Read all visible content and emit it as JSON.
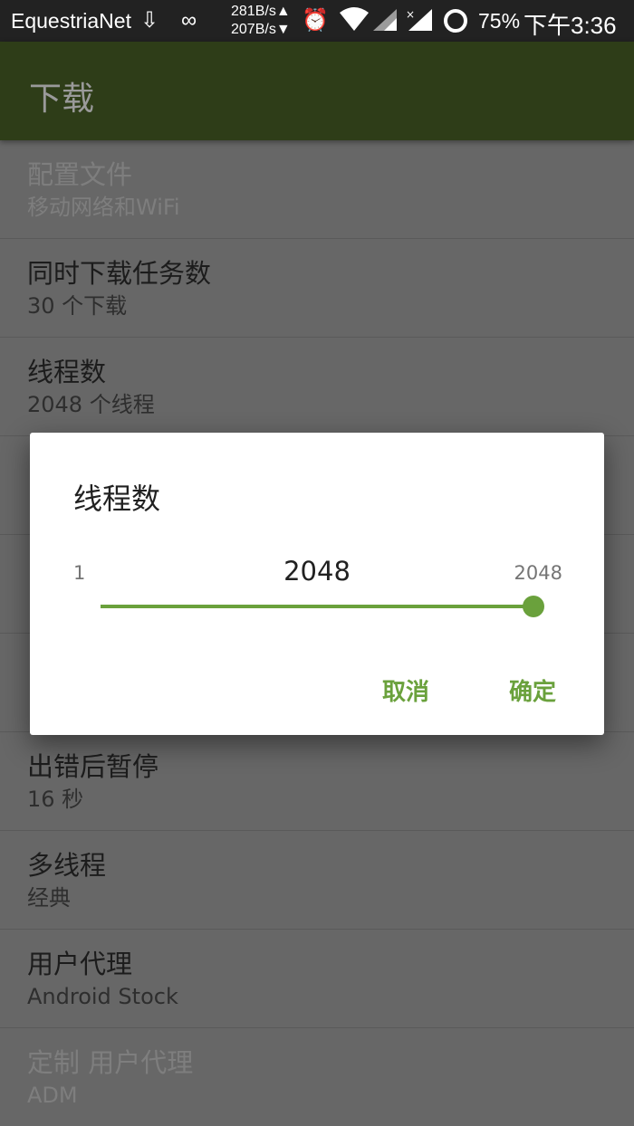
{
  "status_bar": {
    "carrier": "EquestriaNet",
    "speed_up": "281B/s▲",
    "speed_down": "207B/s▼",
    "battery": "75%",
    "time": "下午3:36",
    "icons": [
      "download-notify-icon",
      "infinity-icon",
      "alarm-icon",
      "wifi-icon",
      "signal-icon",
      "signal-x-icon",
      "battery-ring-icon"
    ]
  },
  "app_bar": {
    "title": "下载"
  },
  "settings": [
    {
      "title": "配置文件",
      "summary": "移动网络和WiFi",
      "enabled": false
    },
    {
      "title": "同时下载任务数",
      "summary": "30 个下载",
      "enabled": true
    },
    {
      "title": "线程数",
      "summary": "2048 个线程",
      "enabled": true
    },
    {
      "title": "",
      "summary": "",
      "enabled": true
    },
    {
      "title": "",
      "summary": "",
      "enabled": true
    },
    {
      "title": "",
      "summary": "",
      "enabled": true
    },
    {
      "title": "出错后暂停",
      "summary": "16 秒",
      "enabled": true
    },
    {
      "title": "多线程",
      "summary": "经典",
      "enabled": true
    },
    {
      "title": "用户代理",
      "summary": "Android Stock",
      "enabled": true
    },
    {
      "title": "定制 用户代理",
      "summary": "ADM",
      "enabled": false
    }
  ],
  "dialog": {
    "title": "线程数",
    "slider": {
      "min": "1",
      "max": "2048",
      "value": "2048",
      "fraction": 1.0
    },
    "cancel_label": "取消",
    "ok_label": "确定"
  },
  "colors": {
    "accent": "#6aa13c",
    "app_bar": "#2e3d18"
  }
}
